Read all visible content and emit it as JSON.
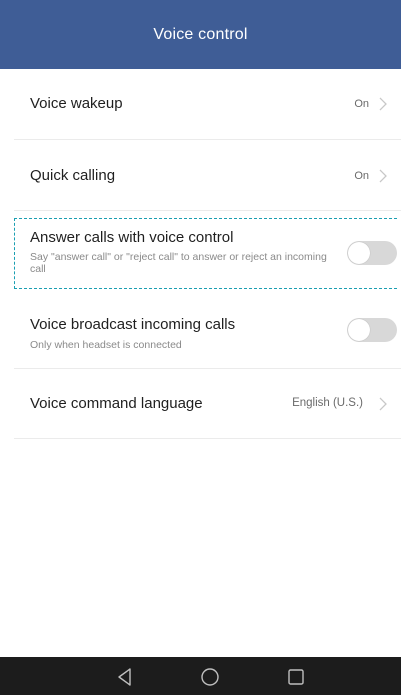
{
  "header": {
    "title": "Voice control"
  },
  "settings": {
    "voice_wakeup": {
      "title": "Voice wakeup",
      "value": "On"
    },
    "quick_calling": {
      "title": "Quick calling",
      "value": "On"
    },
    "answer_calls": {
      "title": "Answer calls with voice control",
      "subtitle": "Say \"answer call\" or \"reject call\" to answer or reject an incoming call",
      "enabled": false
    },
    "voice_broadcast": {
      "title": "Voice broadcast incoming calls",
      "subtitle": "Only when headset is connected",
      "enabled": false
    },
    "command_language": {
      "title": "Voice command language",
      "value": "English (U.S.)"
    }
  },
  "colors": {
    "header_bg": "#3f5d96",
    "highlight_border": "#1a9fb2",
    "toggle_off": "#d8d8d8",
    "navbar_bg": "#1c1c1c"
  },
  "navbar": {
    "icons": [
      "back-icon",
      "home-icon",
      "recents-icon"
    ]
  }
}
